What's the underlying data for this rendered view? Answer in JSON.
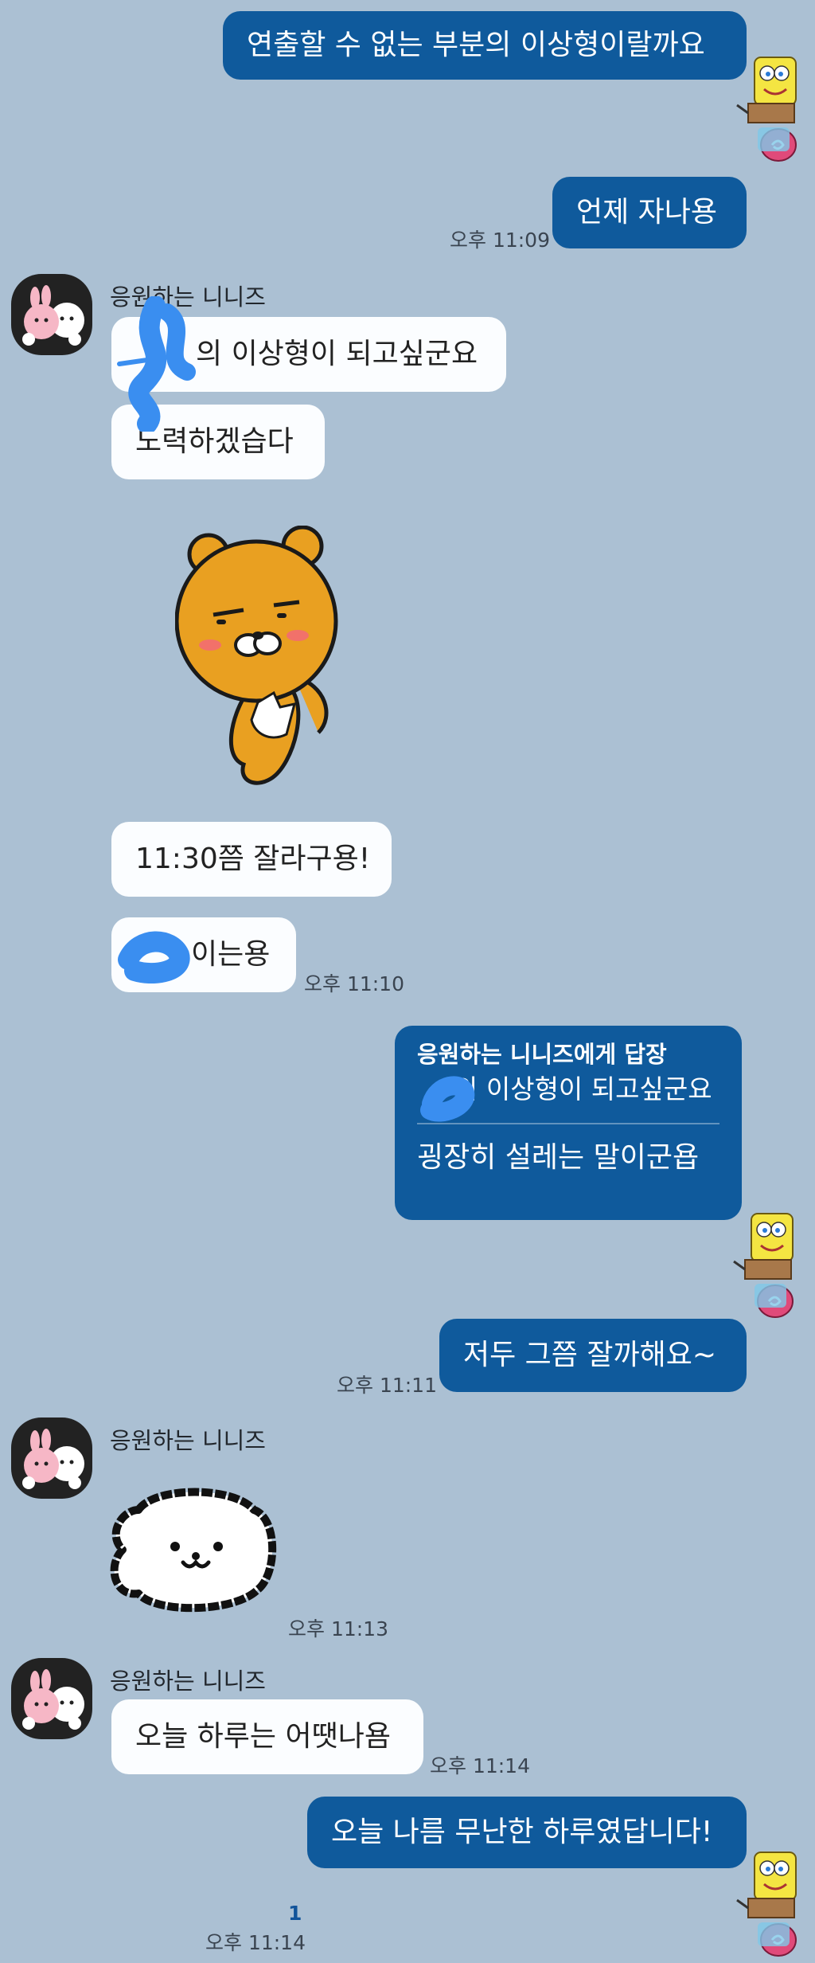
{
  "colors": {
    "background": "#abc0d3",
    "my_bubble": "#0f5a9c",
    "their_bubble": "#fbfdff",
    "unread": "#12549a"
  },
  "messages": {
    "m1": {
      "text": "연출할 수 없는 부분의 이상형이랄까요"
    },
    "m2": {
      "text": "언제 자나용",
      "time": "오후 11:09"
    },
    "g1": {
      "sender": "응원하는 니니즈"
    },
    "m3": {
      "text": "의 이상형이 되고싶군요"
    },
    "m4": {
      "text": "노력하겠습다"
    },
    "sticker1": {
      "icon": "ryan-bear-sticker"
    },
    "m5": {
      "text": "11:30쯤 잘라구용!"
    },
    "m6": {
      "text": "이는용",
      "time": "오후 11:10"
    },
    "reply": {
      "header": "응원하는 니니즈에게 답장",
      "quote": "의 이상형이 되고싶군요",
      "text": "굉장히 설레는 말이군욥"
    },
    "m7": {
      "text": "저두 그쯤 잘까해요~",
      "time": "오후 11:11"
    },
    "g2": {
      "sender": "응원하는 니니즈"
    },
    "sticker2": {
      "icon": "white-puppy-sticker",
      "time": "오후 11:13"
    },
    "g3": {
      "sender": "응원하는 니니즈"
    },
    "m8": {
      "text": "오늘 하루는 어땟나욤",
      "time": "오후 11:14"
    },
    "m9": {
      "text": "오늘 나름 무난한 하루였답니다!",
      "unread": "1",
      "time": "오후 11:14"
    }
  }
}
